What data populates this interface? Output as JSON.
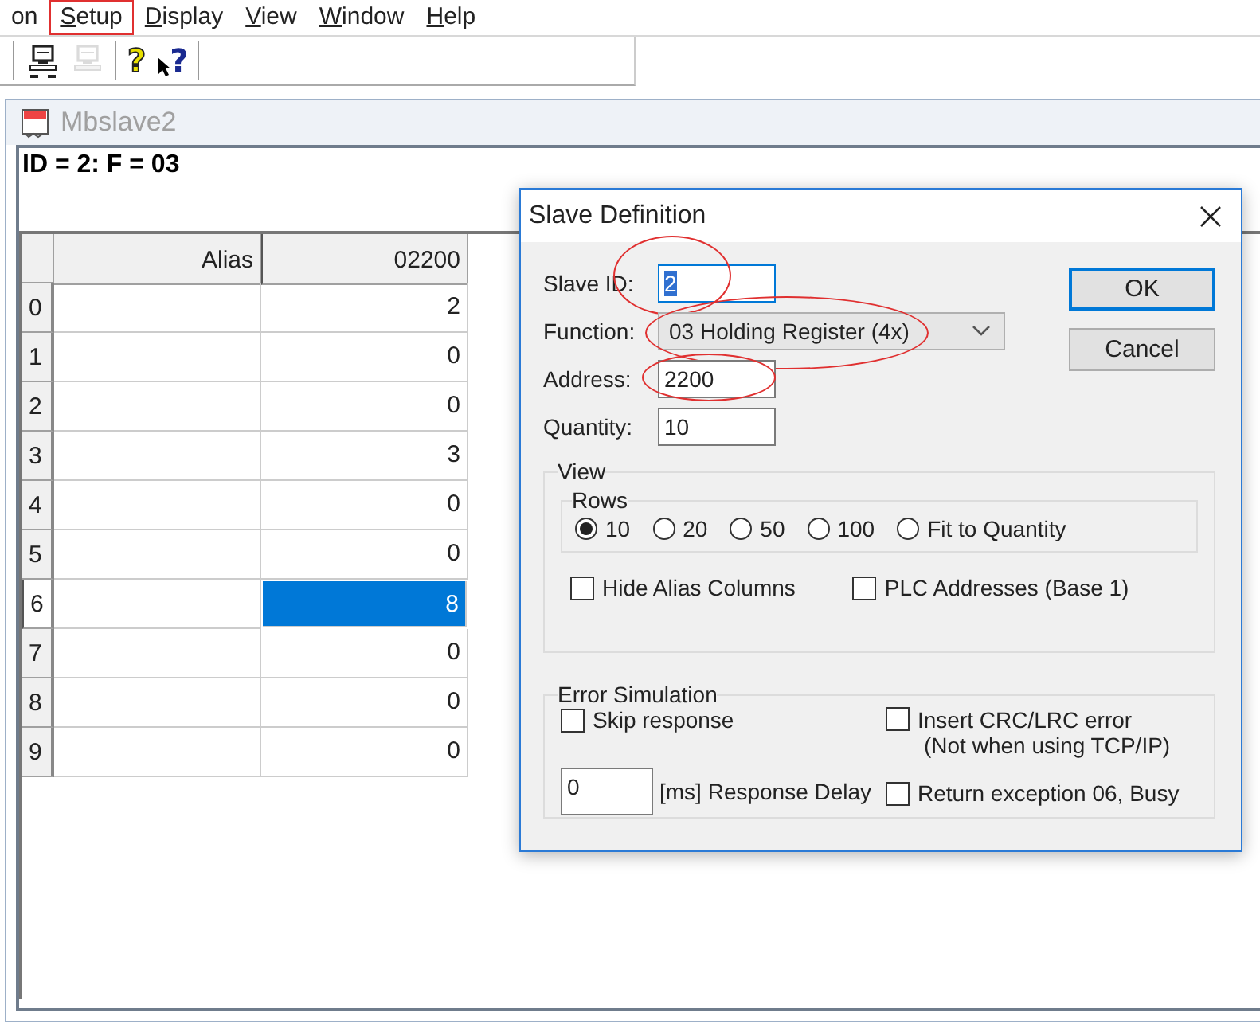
{
  "menu_bar": {
    "items": [
      {
        "label": "on",
        "mnemonic": false,
        "annotated": false
      },
      {
        "label": "Setup",
        "mnemonic": true,
        "annotated": true
      },
      {
        "label": "Display",
        "mnemonic": true,
        "annotated": false
      },
      {
        "label": "View",
        "mnemonic": true,
        "annotated": false
      },
      {
        "label": "Window",
        "mnemonic": true,
        "annotated": false
      },
      {
        "label": "Help",
        "mnemonic": true,
        "annotated": false
      }
    ]
  },
  "toolbar": {
    "buttons": [
      {
        "kind": "connect",
        "disabled": false
      },
      {
        "kind": "disconnect",
        "disabled": true
      },
      {
        "kind": "help",
        "glyph": "?",
        "disabled": false
      },
      {
        "kind": "context-help",
        "glyph": "?",
        "disabled": false
      }
    ]
  },
  "child_window": {
    "title": "Mbslave2",
    "info": "ID = 2: F = 03",
    "table": {
      "columns": [
        "Alias",
        "02200"
      ],
      "rows": [
        {
          "header": "0",
          "value": "2",
          "selected": false
        },
        {
          "header": "1",
          "value": "0",
          "selected": false
        },
        {
          "header": "2",
          "value": "0",
          "selected": false
        },
        {
          "header": "3",
          "value": "3",
          "selected": false
        },
        {
          "header": "4",
          "value": "0",
          "selected": false
        },
        {
          "header": "5",
          "value": "0",
          "selected": false
        },
        {
          "header": "6",
          "value": "8",
          "selected": true
        },
        {
          "header": "7",
          "value": "0",
          "selected": false
        },
        {
          "header": "8",
          "value": "0",
          "selected": false
        },
        {
          "header": "9",
          "value": "0",
          "selected": false
        }
      ]
    }
  },
  "dialog": {
    "title": "Slave Definition",
    "fields": [
      {
        "label": "Slave ID:",
        "kind": "text",
        "value": "2",
        "text_selected": true,
        "annotated": true
      },
      {
        "label": "Function:",
        "kind": "dropdown",
        "value": "03 Holding Register (4x)",
        "annotated": true
      },
      {
        "label": "Address:",
        "kind": "text",
        "value": "2200",
        "text_selected": false,
        "annotated": true
      },
      {
        "label": "Quantity:",
        "kind": "text",
        "value": "10",
        "text_selected": false,
        "annotated": false
      }
    ],
    "buttons": [
      {
        "label": "OK",
        "default": true
      },
      {
        "label": "Cancel",
        "default": false
      }
    ],
    "view": {
      "title": "View",
      "rows_group": {
        "title": "Rows",
        "options": [
          {
            "label": "10",
            "selected": true
          },
          {
            "label": "20",
            "selected": false
          },
          {
            "label": "50",
            "selected": false
          },
          {
            "label": "100",
            "selected": false
          },
          {
            "label": "Fit to Quantity",
            "selected": false
          }
        ]
      },
      "checkboxes": [
        {
          "label": "Hide Alias Columns",
          "checked": false
        },
        {
          "label": "PLC Addresses (Base 1)",
          "checked": false
        }
      ]
    },
    "error_simulation": {
      "title": "Error Simulation",
      "skip_response": {
        "label": "Skip response",
        "checked": false
      },
      "delay": {
        "value": "0",
        "label": "[ms] Response Delay"
      },
      "crc_error": {
        "label": "Insert CRC/LRC error",
        "note": "(Not when using TCP/IP)",
        "checked": false
      },
      "busy": {
        "label": "Return exception 06, Busy",
        "checked": false
      }
    }
  }
}
